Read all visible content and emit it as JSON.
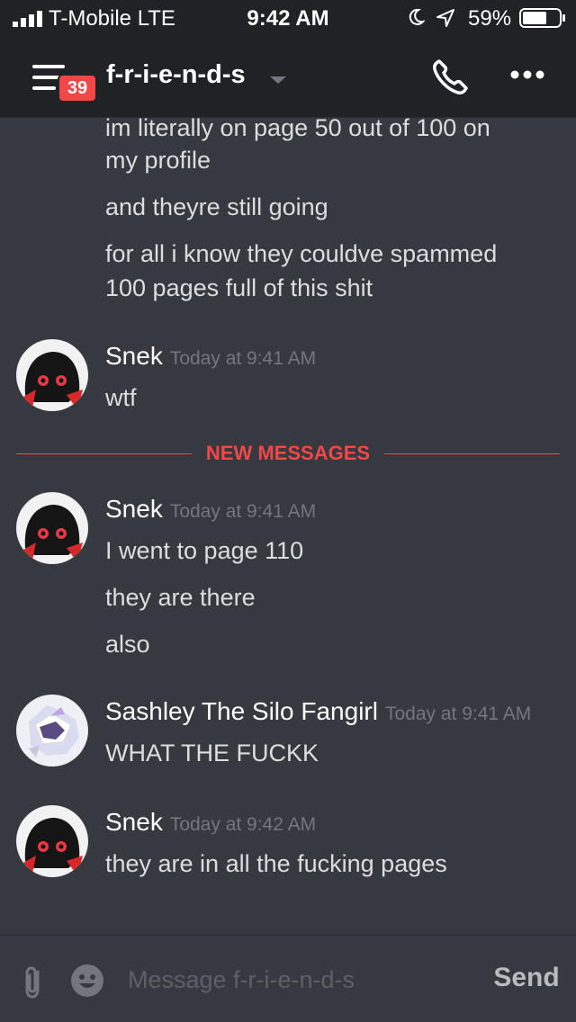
{
  "status_bar": {
    "carrier": "T-Mobile  LTE",
    "time": "9:42 AM",
    "battery_percent": "59%",
    "icons": [
      "signal-icon",
      "moon-icon",
      "location-icon",
      "battery-icon"
    ]
  },
  "header": {
    "unread_badge": "39",
    "channel_name": "f-r-i-e-n-d-s",
    "icons": [
      "menu-icon",
      "chevron-down-icon",
      "phone-icon",
      "more-icon"
    ]
  },
  "messages": {
    "previous_lines": [
      "im literally on page 50 out of 100 on",
      "my profile",
      "and  theyre still going",
      "for all i know they couldve spammed",
      "100 pages full of this shit"
    ],
    "new_messages_label": "NEW MESSAGES",
    "groups": [
      {
        "author": "Snek",
        "timestamp": "Today at 9:41 AM",
        "lines": [
          "wtf"
        ]
      },
      {
        "author": "Snek",
        "timestamp": "Today at 9:41 AM",
        "lines": [
          "I went to page 110",
          "they  are there",
          "also"
        ]
      },
      {
        "author": "Sashley The Silo Fangirl",
        "timestamp": "Today at 9:41 AM",
        "lines": [
          "WHAT THE FUCKK"
        ]
      },
      {
        "author": "Snek",
        "timestamp": "Today at 9:42 AM",
        "lines": [
          "they are in all the fucking pages"
        ]
      }
    ]
  },
  "composer": {
    "placeholder": "Message f-r-i-e-n-d-s",
    "send_label": "Send",
    "icons": [
      "paperclip-icon",
      "emoji-icon"
    ]
  },
  "colors": {
    "background": "#36393f",
    "header": "#202225",
    "new_messages_red": "#f04747",
    "text": "#dcddde",
    "timestamp": "#72767d"
  }
}
